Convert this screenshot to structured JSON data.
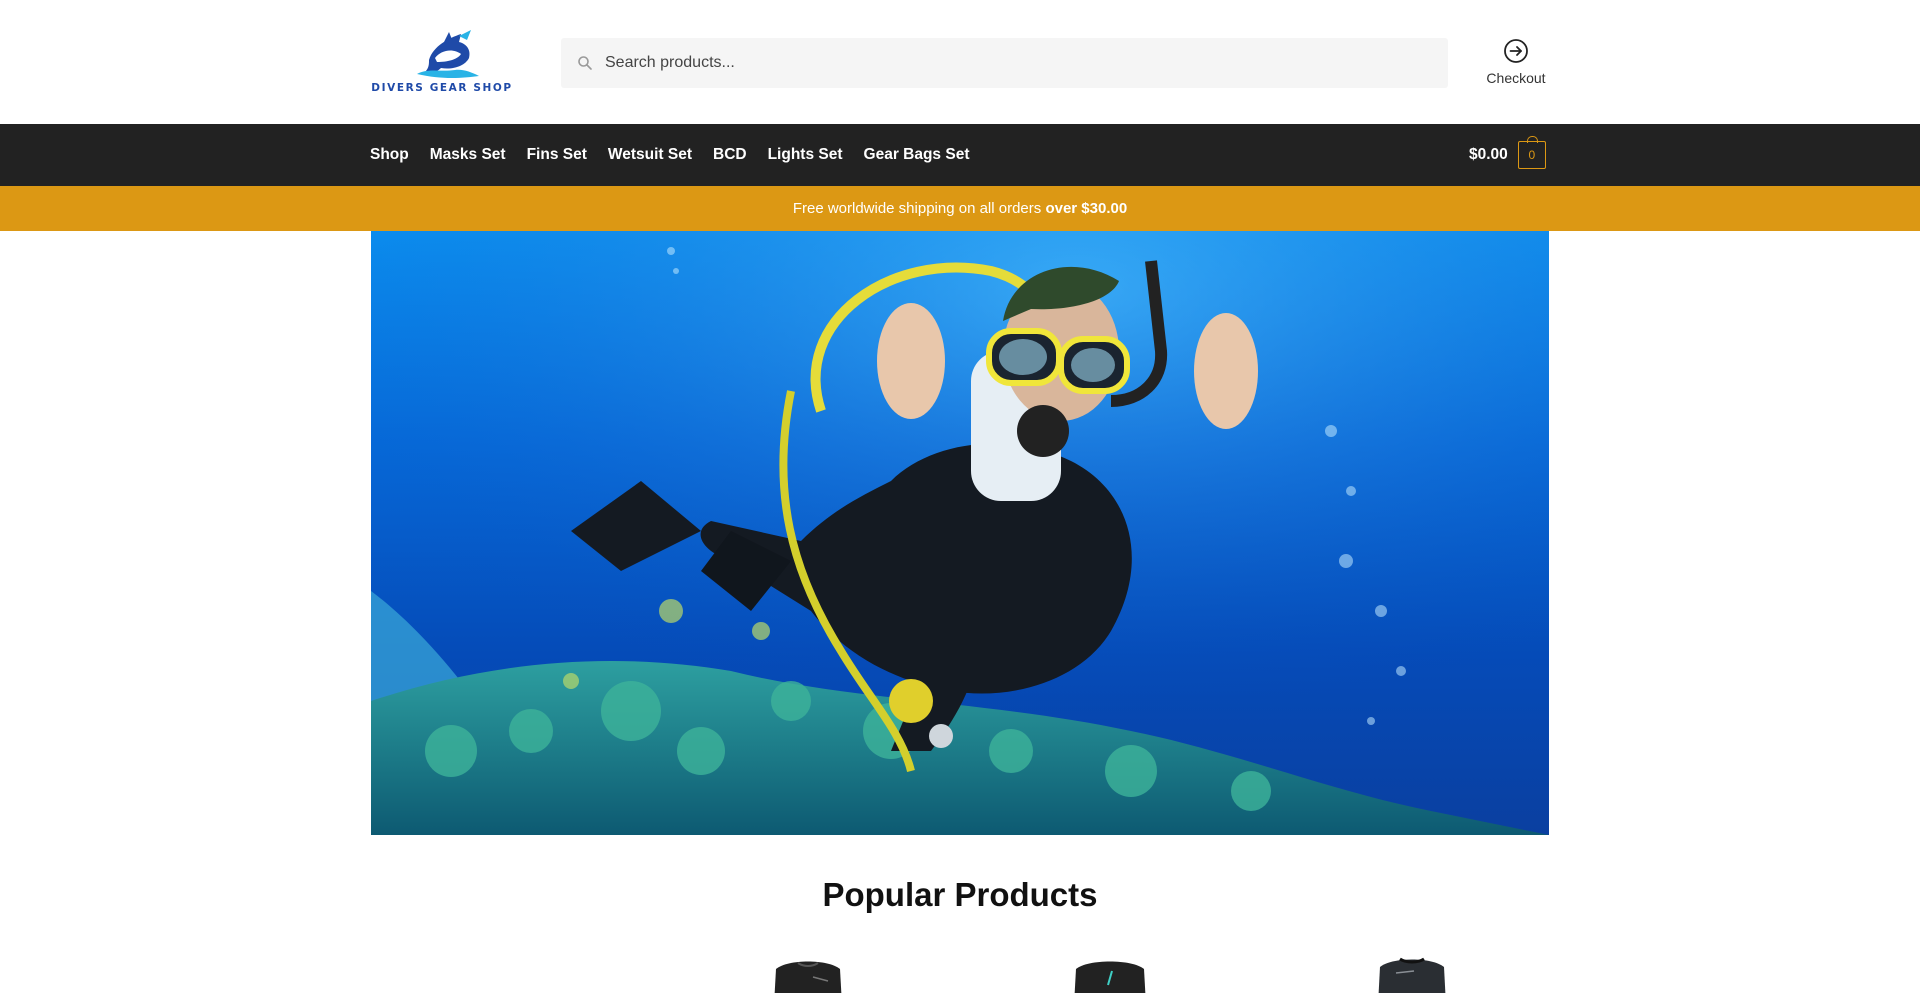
{
  "header": {
    "logo_text": "DIVERS GEAR SHOP",
    "search_placeholder": "Search products...",
    "checkout_label": "Checkout"
  },
  "nav": {
    "items": [
      "Shop",
      "Masks Set",
      "Fins Set",
      "Wetsuit Set",
      "BCD",
      "Lights Set",
      "Gear Bags Set"
    ],
    "cart_total": "$0.00",
    "cart_count": "0"
  },
  "promo": {
    "text": "Free worldwide shipping on all orders",
    "highlight": "over $30.00"
  },
  "products": {
    "title": "Popular Products"
  },
  "colors": {
    "nav_bg": "#222222",
    "accent": "#dc9814",
    "logo_blue": "#1f4aa8"
  },
  "icons": {
    "search": "search-icon",
    "checkout": "arrow-circle-right-icon",
    "cart": "bag-icon"
  }
}
